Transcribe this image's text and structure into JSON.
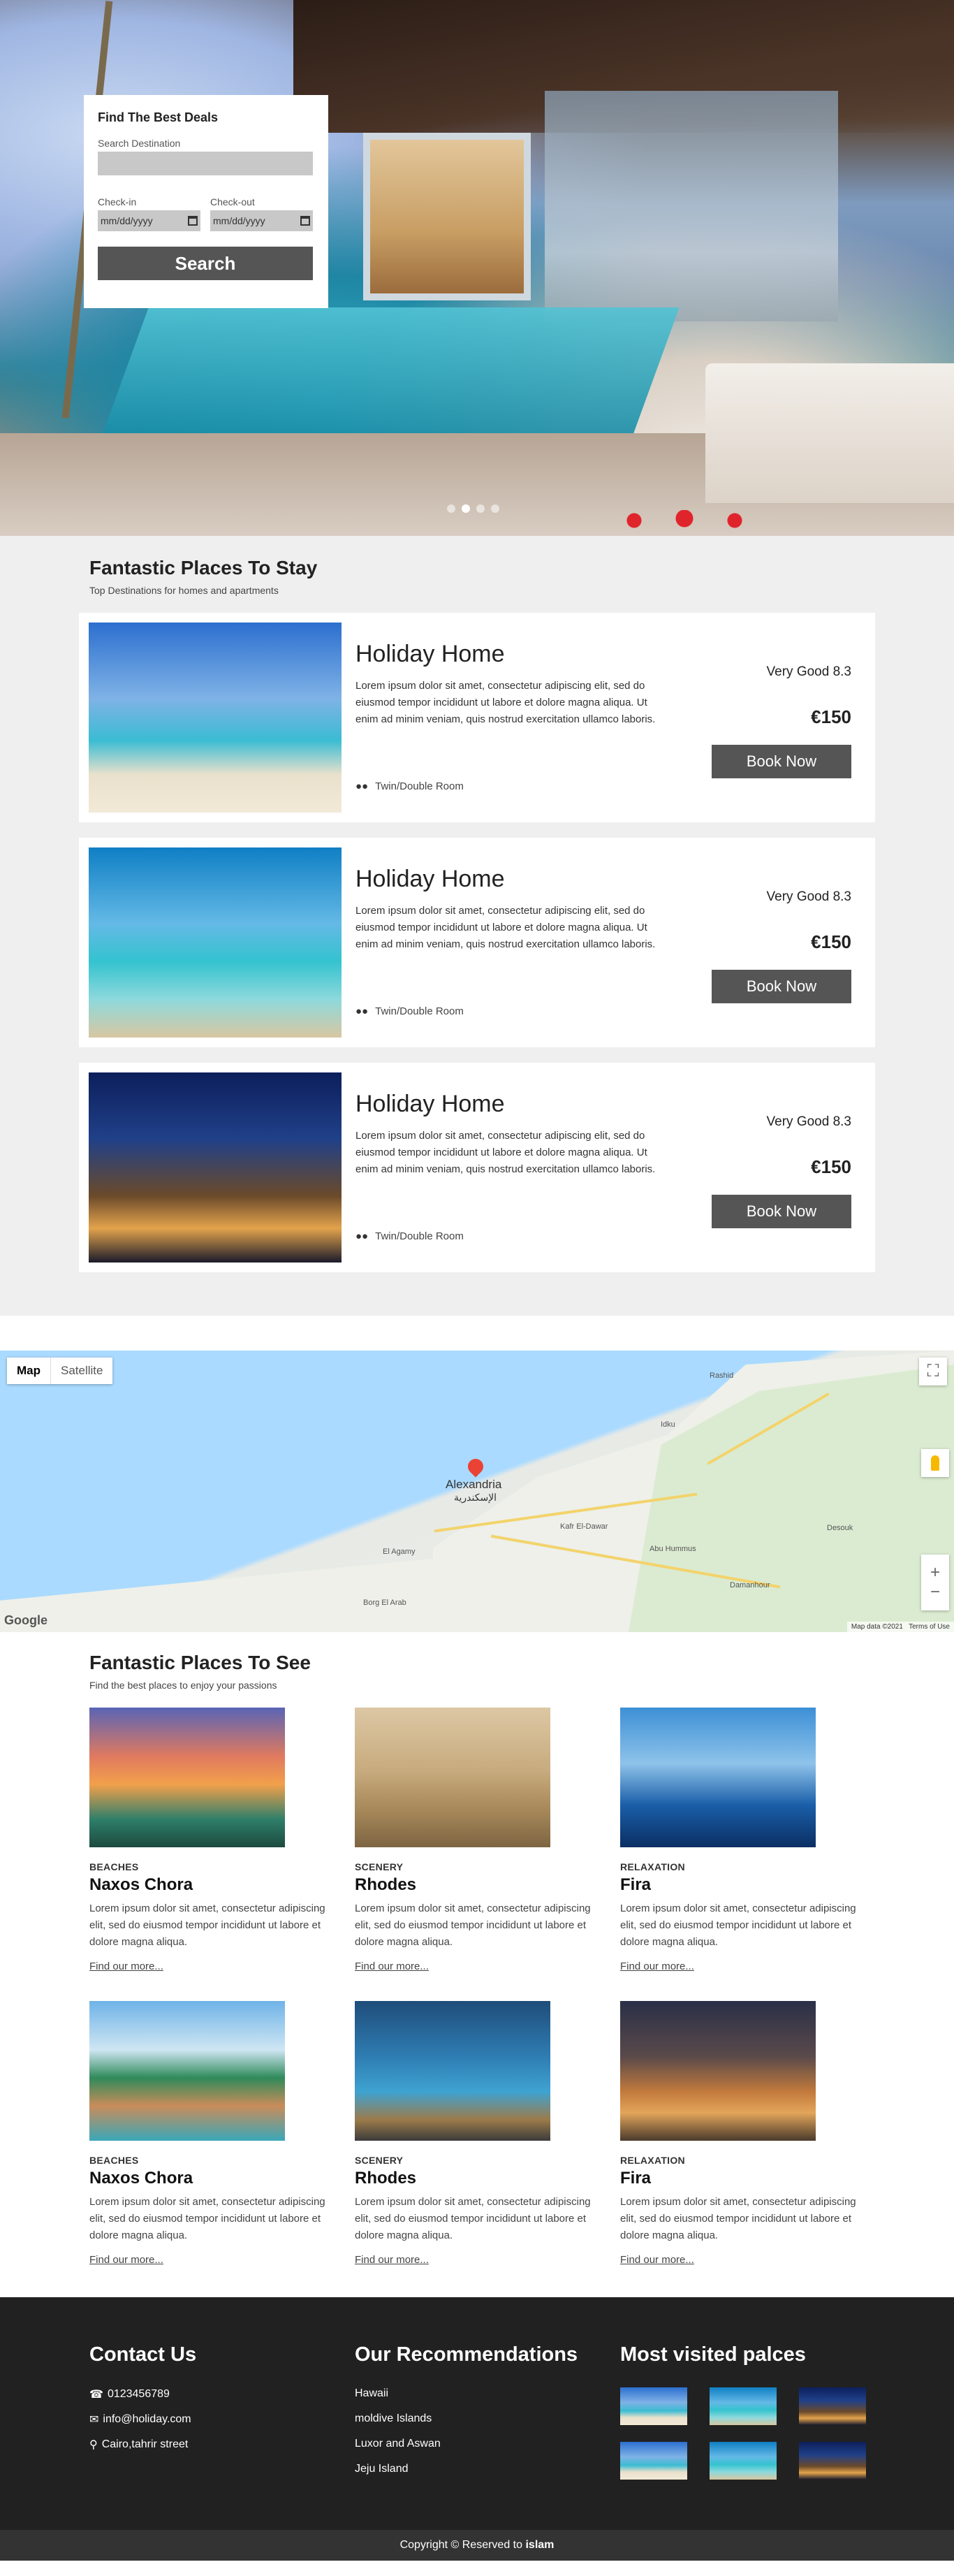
{
  "search": {
    "title": "Find The Best Deals",
    "destination_label": "Search Destination",
    "destination_value": "",
    "checkin_label": "Check-in",
    "checkout_label": "Check-out",
    "date_placeholder": "mm/dd/yyyy",
    "button": "Search"
  },
  "carousel": {
    "slide_count": 4,
    "active_index": 1
  },
  "stay": {
    "title": "Fantastic Places To Stay",
    "subtitle": "Top Destinations for homes and apartments",
    "items": [
      {
        "title": "Holiday Home",
        "text": "Lorem ipsum dolor sit amet, consectetur adipiscing elit, sed do eiusmod tempor incididunt ut labore et dolore magna aliqua. Ut enim ad minim veniam, quis nostrud exercitation ullamco laboris.",
        "room": "Twin/Double Room",
        "rating": "Very Good 8.3",
        "price": "€150",
        "button": "Book Now"
      },
      {
        "title": "Holiday Home",
        "text": "Lorem ipsum dolor sit amet, consectetur adipiscing elit, sed do eiusmod tempor incididunt ut labore et dolore magna aliqua. Ut enim ad minim veniam, quis nostrud exercitation ullamco laboris.",
        "room": "Twin/Double Room",
        "rating": "Very Good 8.3",
        "price": "€150",
        "button": "Book Now"
      },
      {
        "title": "Holiday Home",
        "text": "Lorem ipsum dolor sit amet, consectetur adipiscing elit, sed do eiusmod tempor incididunt ut labore et dolore magna aliqua. Ut enim ad minim veniam, quis nostrud exercitation ullamco laboris.",
        "room": "Twin/Double Room",
        "rating": "Very Good 8.3",
        "price": "€150",
        "button": "Book Now"
      }
    ]
  },
  "map": {
    "tab_map": "Map",
    "tab_satellite": "Satellite",
    "city": "Alexandria",
    "city_ar": "الإسكندرية",
    "google": "Google",
    "attribution": "Map data ©2021",
    "terms": "Terms of Use",
    "places": [
      "Rashid",
      "Idku",
      "Damanhour",
      "Desouk",
      "Kafr El-Dawar",
      "Abu Hummus",
      "El Agamy",
      "Borg El Arab"
    ]
  },
  "see": {
    "title": "Fantastic Places To See",
    "subtitle": "Find the best places to enjoy your passions",
    "items": [
      {
        "category": "BEACHES",
        "name": "Naxos Chora",
        "text": "Lorem ipsum dolor sit amet, consectetur adipiscing elit, sed do eiusmod tempor incididunt ut labore et dolore magna aliqua.",
        "link": "Find our more..."
      },
      {
        "category": "SCENERY",
        "name": "Rhodes",
        "text": "Lorem ipsum dolor sit amet, consectetur adipiscing elit, sed do eiusmod tempor incididunt ut labore et dolore magna aliqua.",
        "link": "Find our more..."
      },
      {
        "category": "RELAXATION",
        "name": "Fira",
        "text": "Lorem ipsum dolor sit amet, consectetur adipiscing elit, sed do eiusmod tempor incididunt ut labore et dolore magna aliqua.",
        "link": "Find our more..."
      },
      {
        "category": "BEACHES",
        "name": "Naxos Chora",
        "text": "Lorem ipsum dolor sit amet, consectetur adipiscing elit, sed do eiusmod tempor incididunt ut labore et dolore magna aliqua.",
        "link": "Find our more..."
      },
      {
        "category": "SCENERY",
        "name": "Rhodes",
        "text": "Lorem ipsum dolor sit amet, consectetur adipiscing elit, sed do eiusmod tempor incididunt ut labore et dolore magna aliqua.",
        "link": "Find our more..."
      },
      {
        "category": "RELAXATION",
        "name": "Fira",
        "text": "Lorem ipsum dolor sit amet, consectetur adipiscing elit, sed do eiusmod tempor incididunt ut labore et dolore magna aliqua.",
        "link": "Find our more..."
      }
    ]
  },
  "footer": {
    "contact_title": "Contact Us",
    "phone": "0123456789",
    "email": "info@holiday.com",
    "address": "Cairo,tahrir street",
    "rec_title": "Our Recommendations",
    "recommendations": [
      "Hawaii",
      "moldive Islands",
      "Luxor and Aswan",
      "Jeju Island"
    ],
    "visited_title": "Most visited palces",
    "copyright": "Copyright © Reserved to",
    "author": "islam"
  },
  "colors": {
    "button": "#555555",
    "footer_bg": "#212121",
    "copyright_bg": "#333333",
    "section_bg": "#efefef"
  }
}
